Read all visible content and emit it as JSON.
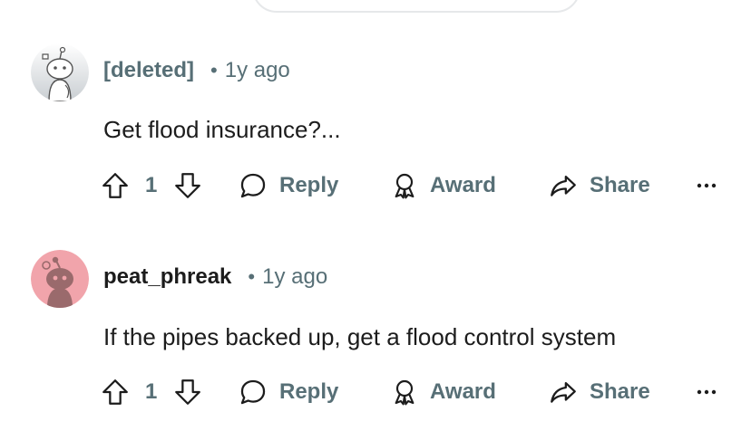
{
  "comments": [
    {
      "author": "[deleted]",
      "time": "1y ago",
      "body": "Get flood insurance?...",
      "votes": "1",
      "actions": {
        "reply": "Reply",
        "award": "Award",
        "share": "Share",
        "more": "..."
      }
    },
    {
      "author": "peat_phreak",
      "time": "1y ago",
      "body": "If the pipes backed up, get a flood control system",
      "votes": "1",
      "actions": {
        "reply": "Reply",
        "award": "Award",
        "share": "Share",
        "more": "..."
      }
    }
  ],
  "separator": "•",
  "colors": {
    "meta": "#576f76",
    "text": "#1c1c1c",
    "avatar2_bg": "#f1a4ab"
  },
  "icons": [
    "upvote-icon",
    "downvote-icon",
    "reply-icon",
    "award-icon",
    "share-icon",
    "more-icon"
  ]
}
